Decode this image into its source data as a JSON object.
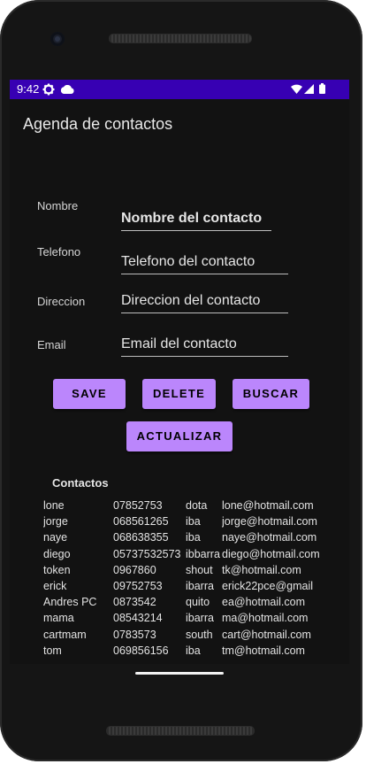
{
  "status_bar": {
    "time": "9:42"
  },
  "app_bar": {
    "title": "Agenda de contactos"
  },
  "form": {
    "nombre": {
      "label": "Nombre",
      "value": "Nombre del contacto"
    },
    "telefono": {
      "label": "Telefono",
      "placeholder": "Telefono del contacto"
    },
    "direccion": {
      "label": "Direccion",
      "placeholder": "Direccion del contacto"
    },
    "email": {
      "label": "Email",
      "placeholder": "Email del contacto"
    }
  },
  "buttons": {
    "save": "SAVE",
    "delete": "DELETE",
    "buscar": "BUSCAR",
    "actualizar": "ACTUALIZAR"
  },
  "contacts": {
    "title": "Contactos",
    "rows": [
      [
        "lone",
        "07852753",
        "dota",
        "lone@hotmail.com"
      ],
      [
        "jorge",
        "068561265",
        "iba",
        "jorge@hotmail.com"
      ],
      [
        "naye",
        "068638355",
        "iba",
        "naye@hotmail.com"
      ],
      [
        "diego",
        "05737532573",
        "ibbarra",
        "diego@hotmail.com"
      ],
      [
        "token",
        "0967860",
        "shout",
        "tk@hotmail.com"
      ],
      [
        "erick",
        "09752753",
        "ibarra",
        "erick22pce@gmail"
      ],
      [
        "Andres PC",
        "0873542",
        "quito",
        "ea@hotmail.com"
      ],
      [
        "mama",
        "08543214",
        "ibarra",
        "ma@hotmail.com"
      ],
      [
        "cartmam",
        "0783573",
        "south",
        "cart@hotmail.com"
      ],
      [
        "tom",
        "069856156",
        "iba",
        "tm@hotmail.com"
      ]
    ]
  },
  "colors": {
    "status_bar": "#3700b3",
    "button": "#bb86fc",
    "background": "#121212"
  }
}
